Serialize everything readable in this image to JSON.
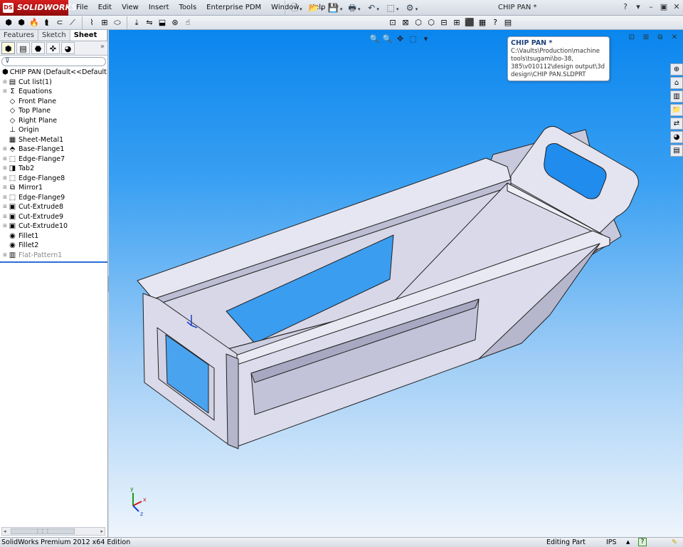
{
  "app": {
    "logo_text": "SOLIDWORKS",
    "logo_badge": "DS",
    "menus": [
      "File",
      "Edit",
      "View",
      "Insert",
      "Tools",
      "Enterprise PDM",
      "Window",
      "Help"
    ],
    "pin_icon": "pin-icon",
    "doc_title": "CHIP PAN *",
    "window_controls": [
      "?",
      "▾",
      "–",
      "▣",
      "✕"
    ]
  },
  "quick_access": [
    {
      "name": "new-document-icon",
      "glyph": "🗋"
    },
    {
      "name": "open-document-icon",
      "glyph": "📂"
    },
    {
      "name": "save-icon",
      "glyph": "💾"
    },
    {
      "name": "print-icon",
      "glyph": "🖶"
    },
    {
      "name": "undo-icon",
      "glyph": "↶"
    },
    {
      "name": "select-icon",
      "glyph": "⬚"
    },
    {
      "name": "rebuild-icon",
      "glyph": "⚙"
    }
  ],
  "toolbar": {
    "left_icons": [
      "⬢",
      "⬢",
      "🔥",
      "⮬",
      "⊂",
      "⟋",
      "⌇",
      "⊞",
      "⬭",
      "⤓",
      "⇋",
      "⬓",
      "⊛",
      "☝"
    ],
    "right_icons": [
      "⊡",
      "⊠",
      "⬡",
      "⬡",
      "⊟",
      "⊞",
      "⬛",
      "▦",
      "?",
      "▤"
    ]
  },
  "command_tabs": [
    "Features",
    "Sketch",
    "Sheet Metal"
  ],
  "active_command_tab": 2,
  "manager_tabs": [
    "⬢",
    "▤",
    "⬣",
    "✜",
    "◕"
  ],
  "manager_more": "»",
  "filter_icon": "⊽",
  "tree": [
    {
      "label": "CHIP PAN  (Default<<Default>_D",
      "icon": "⬢",
      "exp": "",
      "cls": "root"
    },
    {
      "label": "Cut list(1)",
      "icon": "▤",
      "exp": "⊞",
      "cls": ""
    },
    {
      "label": "Equations",
      "icon": "Σ",
      "exp": "⊞",
      "cls": ""
    },
    {
      "label": "Front Plane",
      "icon": "◇",
      "exp": "",
      "cls": ""
    },
    {
      "label": "Top Plane",
      "icon": "◇",
      "exp": "",
      "cls": ""
    },
    {
      "label": "Right Plane",
      "icon": "◇",
      "exp": "",
      "cls": ""
    },
    {
      "label": "Origin",
      "icon": "⊥",
      "exp": "",
      "cls": ""
    },
    {
      "label": "Sheet-Metal1",
      "icon": "▦",
      "exp": "",
      "cls": ""
    },
    {
      "label": "Base-Flange1",
      "icon": "⬘",
      "exp": "⊞",
      "cls": ""
    },
    {
      "label": "Edge-Flange7",
      "icon": "⬚",
      "exp": "⊞",
      "cls": ""
    },
    {
      "label": "Tab2",
      "icon": "◨",
      "exp": "⊞",
      "cls": ""
    },
    {
      "label": "Edge-Flange8",
      "icon": "⬚",
      "exp": "⊞",
      "cls": ""
    },
    {
      "label": "Mirror1",
      "icon": "⧉",
      "exp": "⊞",
      "cls": ""
    },
    {
      "label": "Edge-Flange9",
      "icon": "⬚",
      "exp": "⊞",
      "cls": ""
    },
    {
      "label": "Cut-Extrude8",
      "icon": "▣",
      "exp": "⊞",
      "cls": ""
    },
    {
      "label": "Cut-Extrude9",
      "icon": "▣",
      "exp": "⊞",
      "cls": ""
    },
    {
      "label": "Cut-Extrude10",
      "icon": "▣",
      "exp": "⊞",
      "cls": ""
    },
    {
      "label": "Fillet1",
      "icon": "◉",
      "exp": "",
      "cls": ""
    },
    {
      "label": "Fillet2",
      "icon": "◉",
      "exp": "",
      "cls": ""
    },
    {
      "label": "Flat-Pattern1",
      "icon": "▥",
      "exp": "⊞",
      "cls": "suppressed"
    }
  ],
  "hud_icons": [
    "🔍",
    "🔍",
    "✥",
    "⬚",
    "▾"
  ],
  "viewport_controls": [
    "⊡",
    "⊞",
    "⧉",
    "✕"
  ],
  "taskpane_tabs": [
    "⊕",
    "⌂",
    "▥",
    "📁",
    "⇄",
    "◕",
    "▤"
  ],
  "tooltip": {
    "title": "CHIP PAN *",
    "path": "C:\\Vaults\\Production\\machine tools\\tsugami\\bo-38, 385\\v010112\\design output\\3d design\\CHIP PAN.SLDPRT"
  },
  "triad": {
    "x": "x",
    "y": "y",
    "z": "z"
  },
  "status": {
    "edition": "SolidWorks Premium 2012 x64 Edition",
    "mode": "Editing Part",
    "units": "IPS",
    "units_arrow": "▲",
    "help": "?",
    "pencil": "✎"
  },
  "colors": {
    "part_face_light": "#e8e8f5",
    "part_face_mid": "#c8c8de",
    "part_face_dark": "#9d9db8",
    "part_edge": "#222222",
    "viewport_top": "#0a86ee",
    "viewport_bottom": "#eef5fc"
  }
}
